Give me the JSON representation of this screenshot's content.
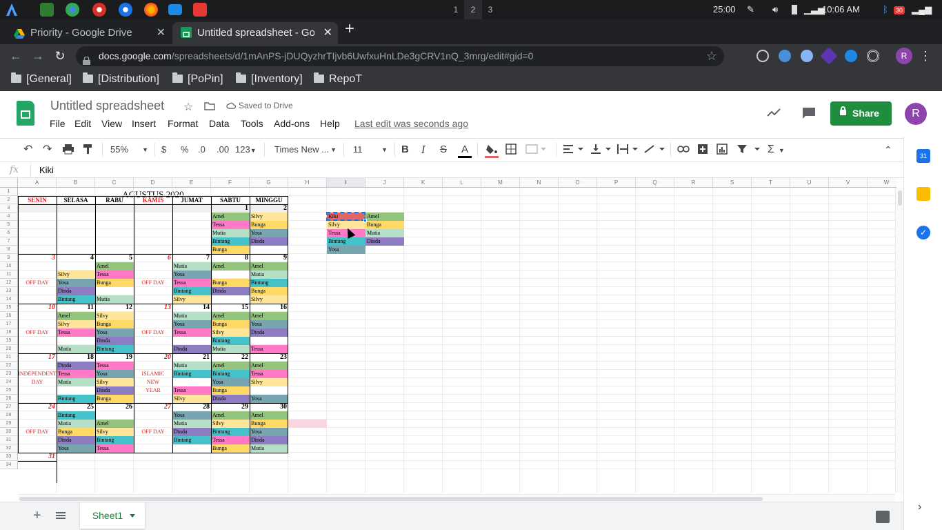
{
  "os": {
    "workspaces": [
      "1",
      "2",
      "3"
    ],
    "timer": "25:00",
    "clock": "10:06 AM",
    "notif_count": "30"
  },
  "browser": {
    "tabs": [
      {
        "label": "Priority - Google Drive",
        "favicon": "google-drive-icon"
      },
      {
        "label": "Untitled spreadsheet - Go",
        "favicon": "google-sheets-icon"
      }
    ],
    "url_host": "docs.google.com",
    "url_path": "/spreadsheets/d/1mAnPS-jDUQyzhrTIjvb6UwfxuHnLDe3gCRV1nQ_3mrg/edit#gid=0",
    "profile_initial": "R",
    "bookmarks": [
      "[General]",
      "[Distribution]",
      "[PoPin]",
      "[Inventory]",
      "RepoT"
    ]
  },
  "sheets": {
    "title": "Untitled spreadsheet",
    "saved_status": "Saved to Drive",
    "menu": [
      "File",
      "Edit",
      "View",
      "Insert",
      "Format",
      "Data",
      "Tools",
      "Add-ons",
      "Help"
    ],
    "last_edit": "Last edit was seconds ago",
    "share_label": "Share",
    "user_initial": "R",
    "toolbar": {
      "zoom": "55%",
      "currency": "$",
      "percent": "%",
      "dec_less": ".0",
      "dec_more": ".00",
      "format_more": "123",
      "font": "Times New ...",
      "font_size": "11",
      "bold": "B",
      "italic": "I",
      "strike": "S",
      "text_color": "A"
    },
    "formula_label": "fx",
    "formula_value": "Kiki",
    "sheet_tab": "Sheet1"
  },
  "grid": {
    "columns": [
      "A",
      "B",
      "C",
      "D",
      "E",
      "F",
      "G",
      "H",
      "I",
      "J",
      "K",
      "L",
      "M",
      "N",
      "O",
      "P",
      "Q",
      "R",
      "S",
      "T",
      "U",
      "V",
      "W"
    ],
    "selected_column": "I",
    "rows": [
      "1",
      "2",
      "3",
      "4",
      "5",
      "6",
      "7",
      "8",
      "9",
      "10",
      "11",
      "12",
      "13",
      "14",
      "15",
      "16",
      "17",
      "18",
      "19",
      "20",
      "21",
      "22",
      "23",
      "24",
      "25",
      "26",
      "27",
      "28",
      "29",
      "30",
      "31",
      "32",
      "33",
      "34"
    ],
    "month_title": "AGUSTUS 2020",
    "day_headers": [
      "SENIN",
      "SELASA",
      "RABU",
      "KAMIS",
      "JUMAT",
      "SABTU",
      "MINGGU"
    ],
    "off_day": "OFF DAY",
    "independence": [
      "INDEPENDENT",
      "DAY"
    ],
    "islamic": [
      "ISLAMIC",
      "NEW",
      "YEAR"
    ],
    "colors": {
      "Amel": "#93c47d",
      "Silvy": "#ffe599",
      "Tessa": "#ff79c6",
      "Mutia": "#b6dfc8",
      "Yosa": "#76a5af",
      "Bunga": "#ffd966",
      "Bintang": "#45c1c9",
      "Dinda": "#8e7cc3",
      "Kiki": "#e06666"
    },
    "day_numbers": [
      {
        "n": "1",
        "col": 5,
        "row": 3,
        "red": false
      },
      {
        "n": "2",
        "col": 6,
        "row": 3,
        "red": false
      },
      {
        "n": "3",
        "col": 0,
        "row": 9,
        "red": true
      },
      {
        "n": "4",
        "col": 1,
        "row": 9,
        "red": false
      },
      {
        "n": "5",
        "col": 2,
        "row": 9,
        "red": false
      },
      {
        "n": "6",
        "col": 3,
        "row": 9,
        "red": true
      },
      {
        "n": "7",
        "col": 4,
        "row": 9,
        "red": false
      },
      {
        "n": "8",
        "col": 5,
        "row": 9,
        "red": false
      },
      {
        "n": "9",
        "col": 6,
        "row": 9,
        "red": false
      },
      {
        "n": "10",
        "col": 0,
        "row": 15,
        "red": true
      },
      {
        "n": "11",
        "col": 1,
        "row": 15,
        "red": false
      },
      {
        "n": "12",
        "col": 2,
        "row": 15,
        "red": false
      },
      {
        "n": "13",
        "col": 3,
        "row": 15,
        "red": true
      },
      {
        "n": "14",
        "col": 4,
        "row": 15,
        "red": false
      },
      {
        "n": "15",
        "col": 5,
        "row": 15,
        "red": false
      },
      {
        "n": "16",
        "col": 6,
        "row": 15,
        "red": false
      },
      {
        "n": "17",
        "col": 0,
        "row": 21,
        "red": true
      },
      {
        "n": "18",
        "col": 1,
        "row": 21,
        "red": false
      },
      {
        "n": "19",
        "col": 2,
        "row": 21,
        "red": false
      },
      {
        "n": "20",
        "col": 3,
        "row": 21,
        "red": true
      },
      {
        "n": "21",
        "col": 4,
        "row": 21,
        "red": false
      },
      {
        "n": "22",
        "col": 5,
        "row": 21,
        "red": false
      },
      {
        "n": "23",
        "col": 6,
        "row": 21,
        "red": false
      },
      {
        "n": "24",
        "col": 0,
        "row": 27,
        "red": true
      },
      {
        "n": "25",
        "col": 1,
        "row": 27,
        "red": false
      },
      {
        "n": "26",
        "col": 2,
        "row": 27,
        "red": false
      },
      {
        "n": "27",
        "col": 3,
        "row": 27,
        "red": true
      },
      {
        "n": "28",
        "col": 4,
        "row": 27,
        "red": false
      },
      {
        "n": "29",
        "col": 5,
        "row": 27,
        "red": false
      },
      {
        "n": "30",
        "col": 6,
        "row": 27,
        "red": false
      },
      {
        "n": "31",
        "col": 0,
        "row": 33,
        "red": true
      }
    ],
    "entries": [
      {
        "col": 5,
        "row": 4,
        "name": "Amel"
      },
      {
        "col": 6,
        "row": 4,
        "name": "Silvy"
      },
      {
        "col": 5,
        "row": 5,
        "name": "Tessa"
      },
      {
        "col": 6,
        "row": 5,
        "name": "Bunga"
      },
      {
        "col": 5,
        "row": 6,
        "name": "Mutia"
      },
      {
        "col": 6,
        "row": 6,
        "name": "Yosa"
      },
      {
        "col": 5,
        "row": 7,
        "name": "Bintang"
      },
      {
        "col": 6,
        "row": 7,
        "name": "Dinda"
      },
      {
        "col": 5,
        "row": 8,
        "name": "Bunga"
      },
      {
        "col": 2,
        "row": 10,
        "name": "Amel"
      },
      {
        "col": 4,
        "row": 10,
        "name": "Mutia"
      },
      {
        "col": 5,
        "row": 10,
        "name": "Amel"
      },
      {
        "col": 6,
        "row": 10,
        "name": "Amel"
      },
      {
        "col": 1,
        "row": 11,
        "name": "Silvy"
      },
      {
        "col": 2,
        "row": 11,
        "name": "Tessa"
      },
      {
        "col": 4,
        "row": 11,
        "name": "Yosa"
      },
      {
        "col": 6,
        "row": 11,
        "name": "Mutia"
      },
      {
        "col": 1,
        "row": 12,
        "name": "Yosa"
      },
      {
        "col": 2,
        "row": 12,
        "name": "Bunga"
      },
      {
        "col": 4,
        "row": 12,
        "name": "Tessa"
      },
      {
        "col": 5,
        "row": 12,
        "name": "Bunga"
      },
      {
        "col": 6,
        "row": 12,
        "name": "Bintang"
      },
      {
        "col": 1,
        "row": 13,
        "name": "Dinda"
      },
      {
        "col": 4,
        "row": 13,
        "name": "Bintang"
      },
      {
        "col": 5,
        "row": 13,
        "name": "Dinda"
      },
      {
        "col": 6,
        "row": 13,
        "name": "Bunga"
      },
      {
        "col": 1,
        "row": 14,
        "name": "Bintang"
      },
      {
        "col": 2,
        "row": 14,
        "name": "Mutia"
      },
      {
        "col": 4,
        "row": 14,
        "name": "Silvy"
      },
      {
        "col": 6,
        "row": 14,
        "name": "Silvy"
      },
      {
        "col": 1,
        "row": 16,
        "name": "Amel"
      },
      {
        "col": 2,
        "row": 16,
        "name": "Silvy"
      },
      {
        "col": 4,
        "row": 16,
        "name": "Mutia"
      },
      {
        "col": 5,
        "row": 16,
        "name": "Amel"
      },
      {
        "col": 6,
        "row": 16,
        "name": "Amel"
      },
      {
        "col": 1,
        "row": 17,
        "name": "Silvy"
      },
      {
        "col": 2,
        "row": 17,
        "name": "Bunga"
      },
      {
        "col": 4,
        "row": 17,
        "name": "Yosa"
      },
      {
        "col": 5,
        "row": 17,
        "name": "Bunga"
      },
      {
        "col": 6,
        "row": 17,
        "name": "Yosa"
      },
      {
        "col": 1,
        "row": 18,
        "name": "Tessa"
      },
      {
        "col": 2,
        "row": 18,
        "name": "Yosa"
      },
      {
        "col": 4,
        "row": 18,
        "name": "Tessa"
      },
      {
        "col": 5,
        "row": 18,
        "name": "Silvy"
      },
      {
        "col": 6,
        "row": 18,
        "name": "Dinda"
      },
      {
        "col": 2,
        "row": 19,
        "name": "Dinda"
      },
      {
        "col": 5,
        "row": 19,
        "name": "Bintang"
      },
      {
        "col": 1,
        "row": 20,
        "name": "Mutia"
      },
      {
        "col": 2,
        "row": 20,
        "name": "Bintang"
      },
      {
        "col": 4,
        "row": 20,
        "name": "Dinda"
      },
      {
        "col": 5,
        "row": 20,
        "name": "Mutia"
      },
      {
        "col": 6,
        "row": 20,
        "name": "Tessa"
      },
      {
        "col": 1,
        "row": 22,
        "name": "Dinda"
      },
      {
        "col": 2,
        "row": 22,
        "name": "Tessa"
      },
      {
        "col": 4,
        "row": 22,
        "name": "Mutia"
      },
      {
        "col": 5,
        "row": 22,
        "name": "Amel"
      },
      {
        "col": 6,
        "row": 22,
        "name": "Amel"
      },
      {
        "col": 1,
        "row": 23,
        "name": "Tessa"
      },
      {
        "col": 2,
        "row": 23,
        "name": "Yosa"
      },
      {
        "col": 4,
        "row": 23,
        "name": "Bintang"
      },
      {
        "col": 5,
        "row": 23,
        "name": "Bintang"
      },
      {
        "col": 6,
        "row": 23,
        "name": "Tessa"
      },
      {
        "col": 1,
        "row": 24,
        "name": "Mutia"
      },
      {
        "col": 2,
        "row": 24,
        "name": "Silvy"
      },
      {
        "col": 5,
        "row": 24,
        "name": "Yosa"
      },
      {
        "col": 6,
        "row": 24,
        "name": "Silvy"
      },
      {
        "col": 2,
        "row": 25,
        "name": "Dinda"
      },
      {
        "col": 4,
        "row": 25,
        "name": "Tessa"
      },
      {
        "col": 5,
        "row": 25,
        "name": "Bunga"
      },
      {
        "col": 1,
        "row": 26,
        "name": "Bintang"
      },
      {
        "col": 2,
        "row": 26,
        "name": "Bunga"
      },
      {
        "col": 4,
        "row": 26,
        "name": "Silvy"
      },
      {
        "col": 5,
        "row": 26,
        "name": "Dinda"
      },
      {
        "col": 6,
        "row": 26,
        "name": "Yosa"
      },
      {
        "col": 1,
        "row": 28,
        "name": "Bintang"
      },
      {
        "col": 4,
        "row": 28,
        "name": "Yosa"
      },
      {
        "col": 5,
        "row": 28,
        "name": "Amel"
      },
      {
        "col": 6,
        "row": 28,
        "name": "Amel"
      },
      {
        "col": 1,
        "row": 29,
        "name": "Mutia"
      },
      {
        "col": 2,
        "row": 29,
        "name": "Amel"
      },
      {
        "col": 4,
        "row": 29,
        "name": "Mutia"
      },
      {
        "col": 5,
        "row": 29,
        "name": "Silvy"
      },
      {
        "col": 6,
        "row": 29,
        "name": "Bunga"
      },
      {
        "col": 1,
        "row": 30,
        "name": "Bunga"
      },
      {
        "col": 2,
        "row": 30,
        "name": "Silvy"
      },
      {
        "col": 4,
        "row": 30,
        "name": "Dinda"
      },
      {
        "col": 5,
        "row": 30,
        "name": "Bintang"
      },
      {
        "col": 6,
        "row": 30,
        "name": "Yosa"
      },
      {
        "col": 1,
        "row": 31,
        "name": "Dinda"
      },
      {
        "col": 2,
        "row": 31,
        "name": "Bintang"
      },
      {
        "col": 4,
        "row": 31,
        "name": "Bintang"
      },
      {
        "col": 5,
        "row": 31,
        "name": "Tessa"
      },
      {
        "col": 6,
        "row": 31,
        "name": "Dinda"
      },
      {
        "col": 1,
        "row": 32,
        "name": "Yosa"
      },
      {
        "col": 2,
        "row": 32,
        "name": "Tessa"
      },
      {
        "col": 5,
        "row": 32,
        "name": "Bunga"
      },
      {
        "col": 6,
        "row": 32,
        "name": "Mutia"
      },
      {
        "col": 8,
        "row": 4,
        "name": "Kiki"
      },
      {
        "col": 9,
        "row": 4,
        "name": "Amel"
      },
      {
        "col": 8,
        "row": 5,
        "name": "Silvy"
      },
      {
        "col": 9,
        "row": 5,
        "name": "Bunga"
      },
      {
        "col": 8,
        "row": 6,
        "name": "Tessa"
      },
      {
        "col": 9,
        "row": 6,
        "name": "Mutia"
      },
      {
        "col": 8,
        "row": 7,
        "name": "Bintang"
      },
      {
        "col": 9,
        "row": 7,
        "name": "Dinda"
      },
      {
        "col": 8,
        "row": 8,
        "name": "Yosa"
      }
    ]
  }
}
